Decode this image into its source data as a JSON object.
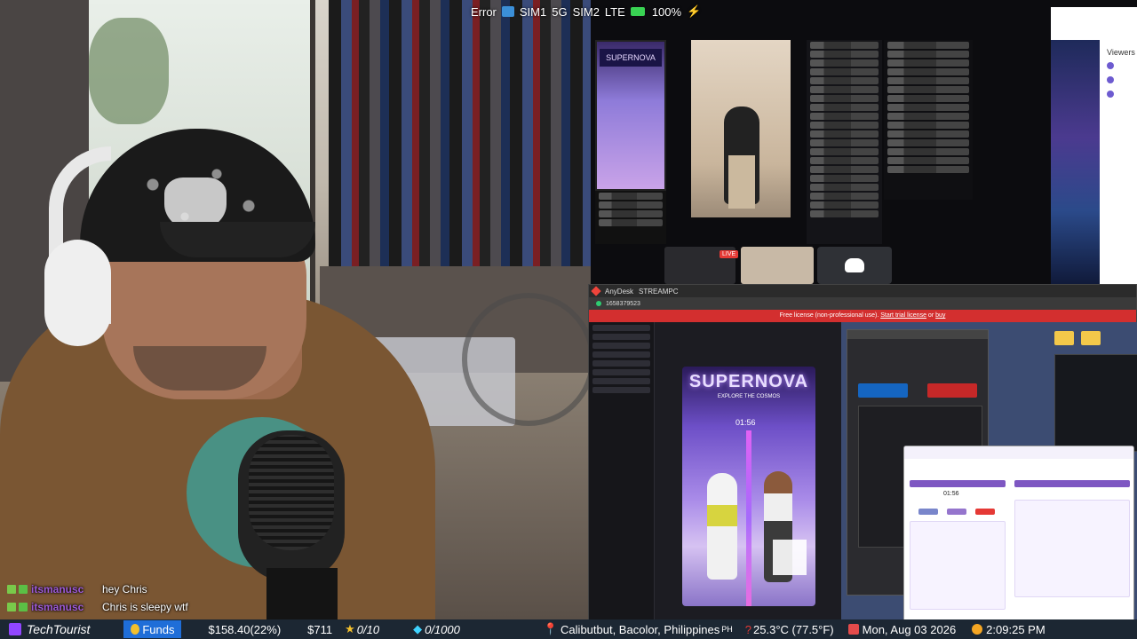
{
  "stream_status": {
    "error_label": "Error",
    "sim1": "SIM1",
    "sim1_net": "5G",
    "sim2": "SIM2",
    "sim2_net": "LTE",
    "battery": "100%",
    "charging_icon": "lightning-icon"
  },
  "chat": {
    "messages": [
      {
        "user": "itsmanusc",
        "text": "hey Chris"
      },
      {
        "user": "itsmanusc",
        "text": "Chris is sleepy wtf"
      }
    ]
  },
  "anydesk": {
    "app_name": "AnyDesk",
    "tab_label": "STREAMPC",
    "address": "1658379523",
    "banner_text": "Free license (non-professional use).",
    "banner_link1": "Start trial license",
    "banner_or": "or",
    "banner_link2": "buy",
    "stream_title": "SUPERNOVA",
    "stream_subtitle": "EXPLORE THE COSMOS",
    "timer": "01:56",
    "dash_timer": "01:56"
  },
  "top_panel": {
    "viewers_label": "Viewers",
    "live_label": "LIVE"
  },
  "ticker": {
    "channel": "TechTourist",
    "funds_label": "Funds",
    "funds_value": "$158.40(22%)",
    "amount": "$711",
    "stars": "0/10",
    "gems": "0/1000",
    "location": "Calibutbut, Bacolor, Philippines",
    "location_code": "PH",
    "weather": "25.3°C (77.5°F)",
    "date": "Mon, Aug 03 2026",
    "time": "2:09:25 PM"
  },
  "colors": {
    "ticker_bg": "#1c2733",
    "funds_bg": "#1f6ed8",
    "banner_red": "#d32f2f",
    "twitch_purple": "#9146ff",
    "chat_user": "#9b59d6"
  }
}
